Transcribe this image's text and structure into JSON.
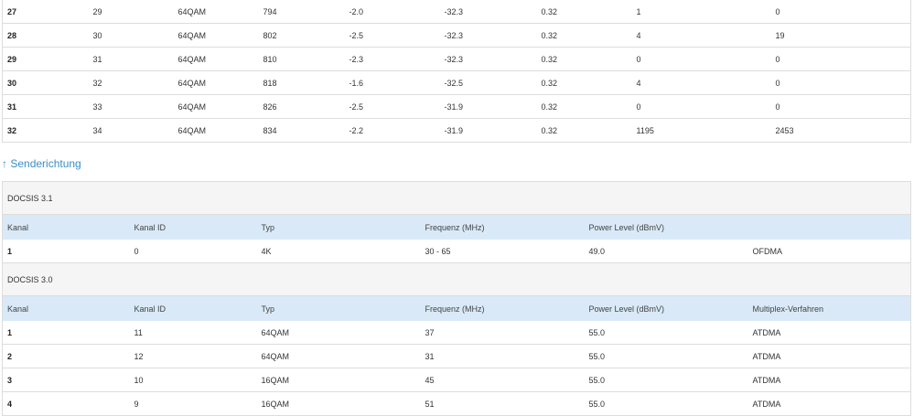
{
  "downstream": {
    "rows": [
      [
        "27",
        "29",
        "64QAM",
        "794",
        "-2.0",
        "-32.3",
        "0.32",
        "1",
        "0"
      ],
      [
        "28",
        "30",
        "64QAM",
        "802",
        "-2.5",
        "-32.3",
        "0.32",
        "4",
        "19"
      ],
      [
        "29",
        "31",
        "64QAM",
        "810",
        "-2.3",
        "-32.3",
        "0.32",
        "0",
        "0"
      ],
      [
        "30",
        "32",
        "64QAM",
        "818",
        "-1.6",
        "-32.5",
        "0.32",
        "4",
        "0"
      ],
      [
        "31",
        "33",
        "64QAM",
        "826",
        "-2.5",
        "-31.9",
        "0.32",
        "0",
        "0"
      ],
      [
        "32",
        "34",
        "64QAM",
        "834",
        "-2.2",
        "-31.9",
        "0.32",
        "1195",
        "2453"
      ]
    ]
  },
  "upstream": {
    "link_arrow": "↑",
    "link_label": "Senderichtung",
    "docsis31": {
      "section_title": "DOCSIS 3.1",
      "headers": [
        "Kanal",
        "Kanal ID",
        "Typ",
        "Frequenz (MHz)",
        "Power Level (dBmV)",
        ""
      ],
      "rows": [
        [
          "1",
          "0",
          "4K",
          "30 - 65",
          "49.0",
          "OFDMA"
        ]
      ]
    },
    "docsis30": {
      "section_title": "DOCSIS 3.0",
      "headers": [
        "Kanal",
        "Kanal ID",
        "Typ",
        "Frequenz (MHz)",
        "Power Level (dBmV)",
        "Multiplex-Verfahren"
      ],
      "rows": [
        [
          "1",
          "11",
          "64QAM",
          "37",
          "55.0",
          "ATDMA"
        ],
        [
          "2",
          "12",
          "64QAM",
          "31",
          "55.0",
          "ATDMA"
        ],
        [
          "3",
          "10",
          "16QAM",
          "45",
          "55.0",
          "ATDMA"
        ],
        [
          "4",
          "9",
          "16QAM",
          "51",
          "55.0",
          "ATDMA"
        ]
      ]
    }
  }
}
